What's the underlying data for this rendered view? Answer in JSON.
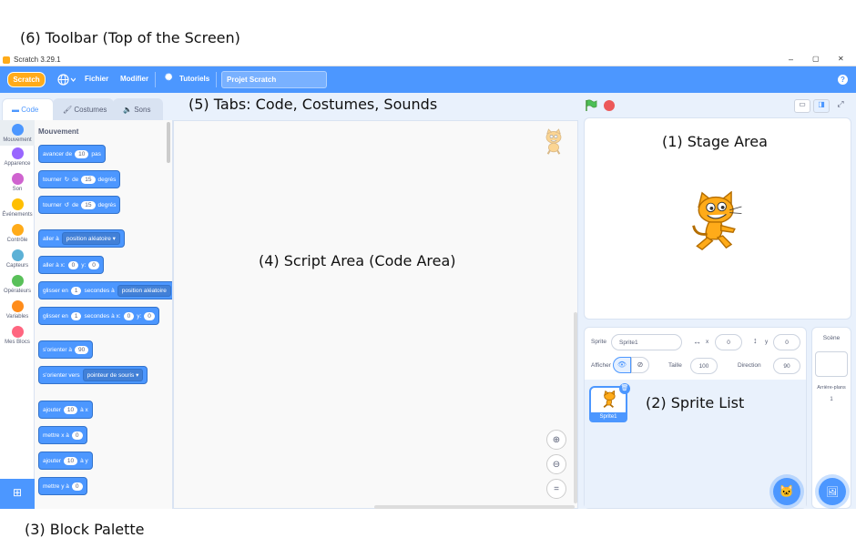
{
  "annotations": {
    "toolbar": "(6) Toolbar (Top of the Screen)",
    "tabs": "(5) Tabs: Code, Costumes, Sounds",
    "stage": "(1) Stage Area",
    "script": "(4) Script Area (Code Area)",
    "sprites": "(2) Sprite List",
    "palette": "(3) Block Palette"
  },
  "window": {
    "title": "Scratch 3.29.1",
    "minimize": "–",
    "maximize": "▢",
    "close": "✕"
  },
  "menubar": {
    "logo": "Scratch",
    "file": "Fichier",
    "edit": "Modifier",
    "tutorials": "Tutoriels",
    "project_title": "Projet Scratch",
    "help_icon": "?"
  },
  "tabs": {
    "code": "Code",
    "costumes": "Costumes",
    "sounds": "Sons"
  },
  "categories": [
    {
      "label": "Mouvement",
      "color": "#4c97ff"
    },
    {
      "label": "Apparence",
      "color": "#9966ff"
    },
    {
      "label": "Son",
      "color": "#cf63cf"
    },
    {
      "label": "Événements",
      "color": "#ffbf00"
    },
    {
      "label": "Contrôle",
      "color": "#ffab19"
    },
    {
      "label": "Capteurs",
      "color": "#5cb1d6"
    },
    {
      "label": "Opérateurs",
      "color": "#59c059"
    },
    {
      "label": "Variables",
      "color": "#ff8c1a"
    },
    {
      "label": "Mes Blocs",
      "color": "#ff6680"
    }
  ],
  "palette": {
    "heading": "Mouvement",
    "move": {
      "a": "avancer de",
      "n": "10",
      "b": "pas"
    },
    "turn_right": {
      "a": "tourner",
      "b": "de",
      "n": "15",
      "c": "degrés"
    },
    "turn_left": {
      "a": "tourner",
      "b": "de",
      "n": "15",
      "c": "degrés"
    },
    "goto": {
      "a": "aller à",
      "menu": "position aléatoire"
    },
    "goto_xy": {
      "a": "aller à x:",
      "x": "0",
      "b": "y:",
      "y": "0"
    },
    "glide_to": {
      "a": "glisser en",
      "n": "1",
      "b": "secondes à",
      "menu": "position aléatoire"
    },
    "glide_xy": {
      "a": "glisser en",
      "n": "1",
      "b": "secondes à x:",
      "x": "0",
      "c": "y:",
      "y": "0"
    },
    "point_dir": {
      "a": "s'orienter à",
      "n": "90"
    },
    "point_towards": {
      "a": "s'orienter vers",
      "menu": "pointeur de souris"
    },
    "change_x": {
      "a": "ajouter",
      "n": "10",
      "b": "à x"
    },
    "set_x": {
      "a": "mettre x à",
      "n": "0"
    },
    "change_y": {
      "a": "ajouter",
      "n": "10",
      "b": "à y"
    },
    "set_y": {
      "a": "mettre y à",
      "n": "0"
    }
  },
  "sprite_info": {
    "sprite_label": "Sprite",
    "sprite_name": "Sprite1",
    "x_label": "x",
    "x_value": "0",
    "y_label": "y",
    "y_value": "0",
    "show_label": "Afficher",
    "size_label": "Taille",
    "size_value": "100",
    "direction_label": "Direction",
    "direction_value": "90"
  },
  "sprite_list": [
    {
      "name": "Sprite1"
    }
  ],
  "scene": {
    "title": "Scène",
    "backdrops_label": "Arrière-plans",
    "backdrops_count": "1"
  },
  "colors": {
    "accent": "#4c97ff",
    "workspace": "#e9f1fc",
    "motion": "#4c97ff"
  }
}
